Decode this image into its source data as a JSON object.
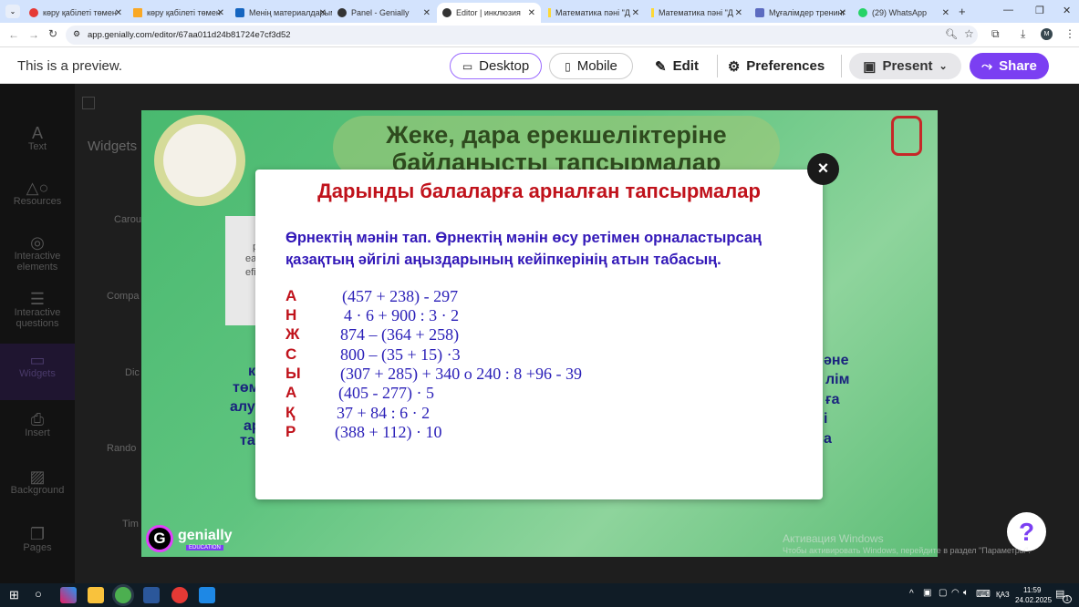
{
  "browser": {
    "tabs": [
      {
        "title": "көру қабілеті төмен",
        "color": "#e53935"
      },
      {
        "title": "көру қабілеті төмен",
        "color": "#f9a825"
      },
      {
        "title": "Менің материалдарым",
        "color": "#1565c0"
      },
      {
        "title": "Panel - Genially",
        "color": "#333333"
      },
      {
        "title": "Editor | инклюзия",
        "color": "#333333",
        "active": true
      },
      {
        "title": "Математика пәні \"Д",
        "color": "#fdd835"
      },
      {
        "title": "Математика пәні \"Д",
        "color": "#fdd835"
      },
      {
        "title": "Мұғалімдер тренинг",
        "color": "#5c6bc0"
      },
      {
        "title": "(29) WhatsApp",
        "color": "#25d366"
      }
    ],
    "url": "app.genially.com/editor/67aa011d24b81724e7cf3d52",
    "profile_initial": "M"
  },
  "preview_bar": {
    "notice": "This is a preview.",
    "desktop": "Desktop",
    "mobile": "Mobile",
    "edit": "Edit",
    "preferences": "Preferences",
    "present": "Present",
    "share": "Share",
    "accent": "#7b3ff2"
  },
  "sidebar": {
    "items": [
      {
        "label": "Text",
        "icon": "text-icon"
      },
      {
        "label": "Resources",
        "icon": "shapes-icon"
      },
      {
        "label": "Interactive elements",
        "icon": "cursor-click-icon"
      },
      {
        "label": "Interactive questions",
        "icon": "checklist-icon"
      },
      {
        "label": "Widgets",
        "icon": "widget-icon",
        "active": true
      },
      {
        "label": "Insert",
        "icon": "insert-icon"
      },
      {
        "label": "Background",
        "icon": "background-icon"
      },
      {
        "label": "Pages",
        "icon": "pages-icon"
      }
    ]
  },
  "panel": {
    "title": "Widgets",
    "items": [
      "Carou",
      "Compa",
      "Dic",
      "Rando",
      "Tim"
    ]
  },
  "slide": {
    "title": "Жеке, дара ерекшеліктеріне байланысты тапсырмалар",
    "left_fragments": [
      "к",
      "төм",
      "алу",
      "ар",
      "та"
    ],
    "right_fragments": [
      "әне",
      "лім",
      "ға",
      "і",
      "а"
    ],
    "background_fragments": [
      "р",
      "ead",
      "efit"
    ],
    "logo_text": "genially",
    "logo_badge": "EDUCATION"
  },
  "modal": {
    "title": "Дарынды балаларға арналған тапсырмалар",
    "instruction": "Өрнектің мәнін тап. Өрнектің мәнін өсу ретімен орналастырсаң қазақтың әйгілі аңыздарының кейіпкерінің атын табасың.",
    "rows": [
      {
        "letter": "А",
        "expr": "(457 + 238) - 297"
      },
      {
        "letter": "Н",
        "expr": "4 · 6 + 900 : 3 · 2"
      },
      {
        "letter": "Ж",
        "expr": "874 – (364 + 258)"
      },
      {
        "letter": "С",
        "expr": "800 – (35 + 15) ·3"
      },
      {
        "letter": "Ы",
        "expr": "(307 + 285) + 340 о 240 : 8 +96 - 39"
      },
      {
        "letter": "А",
        "expr": "(405 - 277) · 5"
      },
      {
        "letter": "Қ",
        "expr": "37 + 84 : 6 · 2"
      },
      {
        "letter": "Р",
        "expr": "(388 + 112) · 10"
      }
    ],
    "close": "×"
  },
  "help": "?",
  "watermark": {
    "line1": "Активация Windows",
    "line2": "Чтобы активировать Windows, перейдите в раздел \"Параметры\"."
  },
  "taskbar": {
    "lang": "ҚАЗ",
    "time": "11:59",
    "date": "24.02.2025",
    "notifications": "1"
  }
}
